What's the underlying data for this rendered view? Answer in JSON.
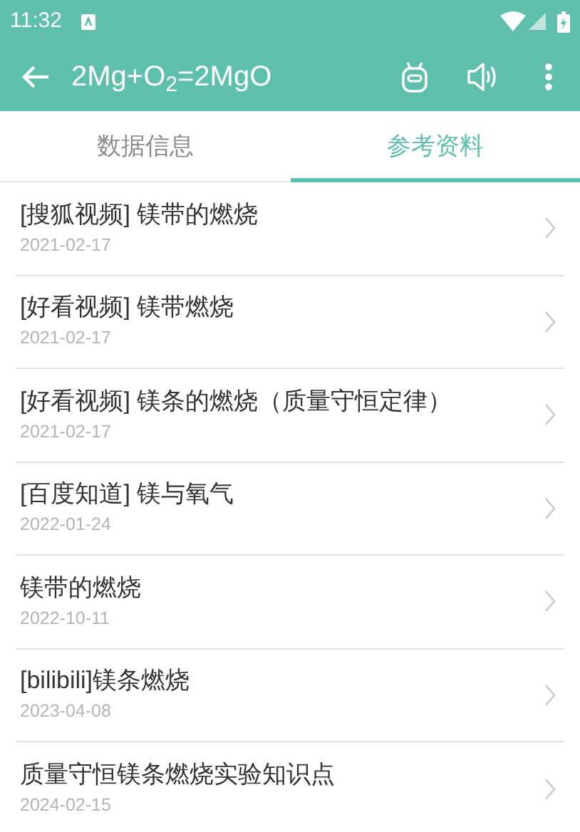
{
  "status_bar": {
    "time": "11:32"
  },
  "app_bar": {
    "title": "2Mg+O$_{2}$=2MgO"
  },
  "tabs": [
    {
      "label": "数据信息",
      "selected": false
    },
    {
      "label": "参考资料",
      "selected": true
    }
  ],
  "items": [
    {
      "title": "[搜狐视频] 镁带的燃烧",
      "date": "2021-02-17"
    },
    {
      "title": "[好看视频] 镁带燃烧",
      "date": "2021-02-17"
    },
    {
      "title": "[好看视频] 镁条的燃烧（质量守恒定律）",
      "date": "2021-02-17"
    },
    {
      "title": "[百度知道] 镁与氧气",
      "date": "2022-01-24"
    },
    {
      "title": "镁带的燃烧",
      "date": "2022-10-11"
    },
    {
      "title": "[bilibili]镁条燃烧",
      "date": "2023-04-08"
    },
    {
      "title": "质量守恒镁条燃烧实验知识点",
      "date": "2024-02-15"
    }
  ]
}
